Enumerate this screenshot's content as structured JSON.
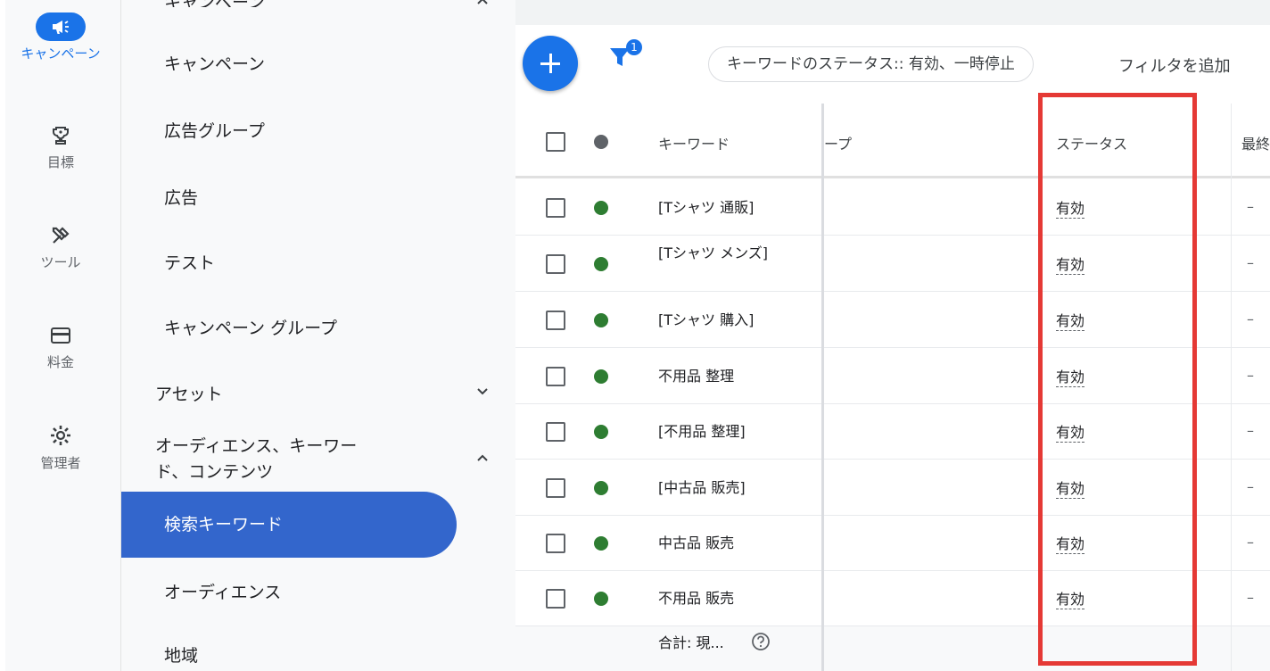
{
  "rail": {
    "items": [
      {
        "label": "キャンペーン",
        "icon": "megaphone-icon",
        "active": true
      },
      {
        "label": "目標",
        "icon": "trophy-icon"
      },
      {
        "label": "ツール",
        "icon": "tools-icon"
      },
      {
        "label": "料金",
        "icon": "credit-card-icon"
      },
      {
        "label": "管理者",
        "icon": "gear-icon"
      }
    ]
  },
  "nav": {
    "top_partial": "キャンペーン",
    "items": [
      "キャンペーン",
      "広告グループ",
      "広告",
      "テスト",
      "キャンペーン グループ"
    ],
    "section_assets": "アセット",
    "section_audience": "オーディエンス、キーワード、コンテンツ",
    "active_item": "検索キーワード",
    "sub_audience": "オーディエンス",
    "sub_region": "地域"
  },
  "toolbar": {
    "filter_count": "1",
    "chip_label": "キーワードのステータス:: 有効、一時停止",
    "add_filter": "フィルタを追加"
  },
  "table": {
    "headers": {
      "keyword": "キーワード",
      "group_partial": "ープ",
      "status": "ステータス",
      "last_partial": "最終"
    },
    "rows": [
      {
        "keyword": "[Tシャツ 通販]",
        "status": "有効",
        "last": "–"
      },
      {
        "keyword": "[Tシャツ メンズ]",
        "status": "有効",
        "last": "–"
      },
      {
        "keyword": "[Tシャツ 購入]",
        "status": "有効",
        "last": "–"
      },
      {
        "keyword": "不用品 整理",
        "status": "有効",
        "last": "–"
      },
      {
        "keyword": "[不用品 整理]",
        "status": "有効",
        "last": "–"
      },
      {
        "keyword": "[中古品 販売]",
        "status": "有効",
        "last": "–"
      },
      {
        "keyword": "中古品 販売",
        "status": "有効",
        "last": "–"
      },
      {
        "keyword": "不用品 販売",
        "status": "有効",
        "last": "–"
      }
    ],
    "total_label": "合計: 現...",
    "help_icon": "help-circle-icon"
  },
  "colors": {
    "accent": "#1a73e8",
    "nav_active": "#3366cc",
    "enabled_dot": "#2e7d32",
    "highlight_box": "#e53935"
  }
}
